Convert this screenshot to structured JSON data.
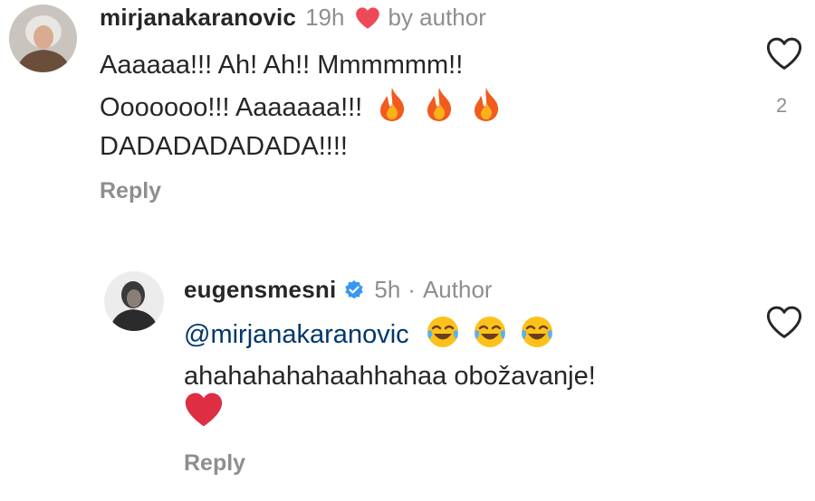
{
  "comments": [
    {
      "username": "mirjanakaranovic",
      "time": "19h",
      "separator": "·",
      "liked_label": "by author",
      "lines": [
        "Aaaaaa!!! Ah! Ah!! Mmmmmm!!",
        "Ooooooo!!! Aaaaaaa!!!",
        "DADADADADADA!!!!"
      ],
      "line2_emoji": "fire-icon x3",
      "reply_label": "Reply",
      "like_count": "2"
    },
    {
      "username": "eugensmesni",
      "time": "5h",
      "separator": "·",
      "author_label": "Author",
      "mention": "@mirjanakaranovic",
      "line1_emoji": "laughing-icon x3",
      "line2": "ahahahahahaahhahaa obožavanje!",
      "line3_emoji": "red-heart-icon",
      "reply_label": "Reply"
    }
  ],
  "colors": {
    "text": "#262626",
    "muted": "#8e8e8e",
    "mention": "#00376b",
    "like_red": "#ed4956",
    "verified_blue": "#3897f0"
  }
}
